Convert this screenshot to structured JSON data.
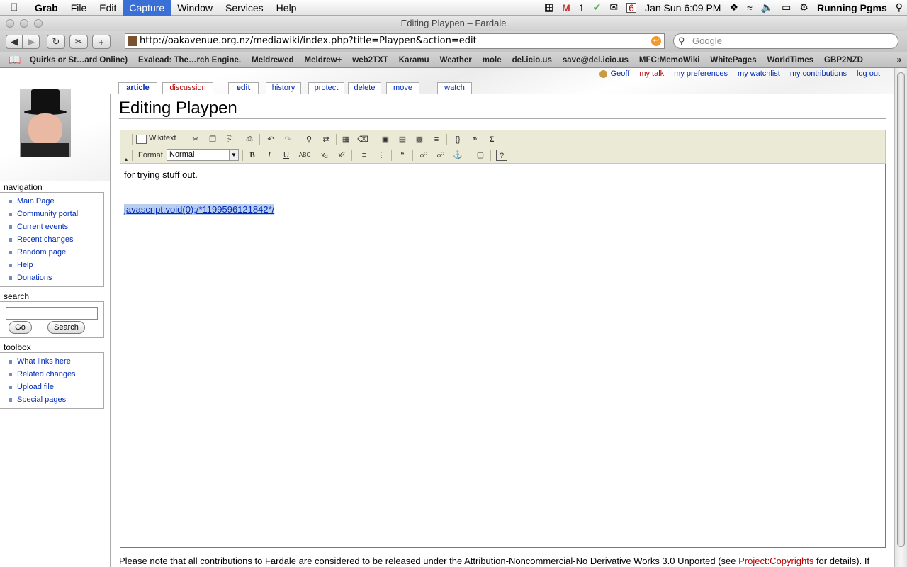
{
  "menubar": {
    "app": "Grab",
    "items": [
      "File",
      "Edit",
      "Capture",
      "Window",
      "Services",
      "Help"
    ],
    "gmail_count": "1",
    "calendar_day": "6",
    "clock": "Jan Sun 6:09 PM",
    "running": "Running Pgms"
  },
  "window": {
    "title": "Editing Playpen – Fardale"
  },
  "browser": {
    "url": "http://oakavenue.org.nz/mediawiki/index.php?title=Playpen&action=edit",
    "search_placeholder": "Google",
    "bookmarks": [
      "Quirks or St…ard Online)",
      "Exalead: The…rch Engine.",
      "Meldrewed",
      "Meldrew+",
      "web2TXT",
      "Karamu",
      "Weather",
      "mole",
      "del.icio.us",
      "save@del.icio.us",
      "MFC:MemoWiki",
      "WhitePages",
      "WorldTimes",
      "GBP2NZD"
    ],
    "bookmarks_more": "»"
  },
  "user_links": {
    "user": "Geoff",
    "talk": "my talk",
    "preferences": "my preferences",
    "watchlist": "my watchlist",
    "contributions": "my contributions",
    "logout": "log out"
  },
  "tabs": {
    "article": "article",
    "discussion": "discussion",
    "edit": "edit",
    "history": "history",
    "protect": "protect",
    "delete": "delete",
    "move": "move",
    "watch": "watch"
  },
  "page": {
    "title": "Editing Playpen",
    "wikitext_label": "Wikitext",
    "format_label": "Format",
    "format_value": "Normal",
    "content_line1": "for trying stuff out.",
    "content_link": "javascript:void(0);/*1199596121842*/",
    "footnote_before": "Please note that all contributions to Fardale are considered to be released under the Attribution-Noncommercial-No Derivative Works 3.0 Unported (see ",
    "footnote_link": "Project:Copyrights",
    "footnote_after": " for details). If"
  },
  "sidebar": {
    "navigation_title": "navigation",
    "navigation": [
      "Main Page",
      "Community portal",
      "Current events",
      "Recent changes",
      "Random page",
      "Help",
      "Donations"
    ],
    "search_title": "search",
    "go_label": "Go",
    "search_label": "Search",
    "toolbox_title": "toolbox",
    "toolbox": [
      "What links here",
      "Related changes",
      "Upload file",
      "Special pages"
    ]
  }
}
